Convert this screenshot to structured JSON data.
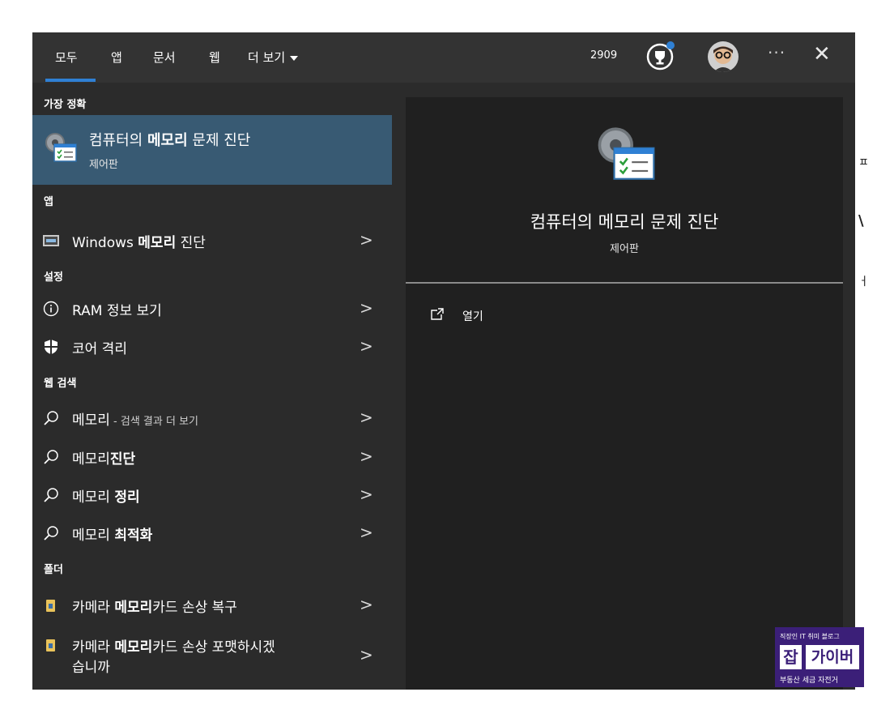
{
  "tabs": [
    "모두",
    "앱",
    "문서",
    "웹",
    "더 보기"
  ],
  "header": {
    "points": "2909"
  },
  "sections": {
    "best": "가장 정확",
    "apps": "앱",
    "settings": "설정",
    "web": "웹 검색",
    "folders": "폴더"
  },
  "best_match": {
    "title_pre": "컴퓨터의 ",
    "title_bold": "메모리",
    "title_post": " 문제 진단",
    "subtitle": "제어판"
  },
  "apps": [
    {
      "pre": "Windows ",
      "bold": "메모리",
      "post": " 진단"
    }
  ],
  "settings": [
    {
      "label": "RAM 정보 보기"
    },
    {
      "label": "코어 격리"
    }
  ],
  "web": [
    {
      "pre": "메모리",
      "bold": "",
      "post": " - 검색 결과 더 보기"
    },
    {
      "pre": "메모리",
      "bold": "진단",
      "post": ""
    },
    {
      "pre": "메모리 ",
      "bold": "정리",
      "post": ""
    },
    {
      "pre": "메모리 ",
      "bold": "최적화",
      "post": ""
    }
  ],
  "folders": [
    {
      "pre": "카메라 ",
      "bold": "메모리",
      "post": "카드 손상 복구"
    },
    {
      "pre": "카메라 ",
      "bold": "메모리",
      "post": "카드 손상 포맷하시겠",
      "line2": "습니까"
    }
  ],
  "preview": {
    "title": "컴퓨터의 메모리 문제 진단",
    "subtitle": "제어판",
    "open_label": "열기"
  },
  "watermark": {
    "top": "직장인 IT 취미 블로그",
    "left": "잡",
    "right": "가이버",
    "bottom": "부동산 세금 자전거"
  },
  "colors": {
    "selected": "#385a73",
    "accent": "#2f80d4",
    "panel": "#2b2b2b"
  }
}
